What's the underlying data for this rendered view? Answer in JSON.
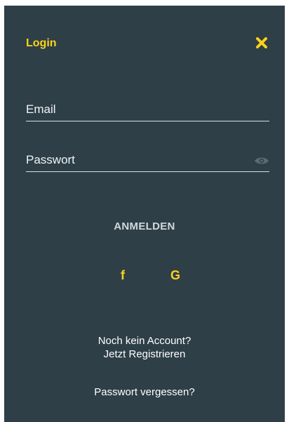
{
  "dialog": {
    "title": "Login",
    "close_icon": "close-icon"
  },
  "form": {
    "email": {
      "placeholder": "Email",
      "value": ""
    },
    "password": {
      "placeholder": "Passwort",
      "value": "",
      "toggle_icon": "eye-icon"
    },
    "submit_label": "ANMELDEN"
  },
  "social": {
    "facebook": "f",
    "google": "G"
  },
  "footer": {
    "register_prompt": "Noch kein Account?",
    "register_link": "Jetzt Registrieren",
    "forgot_password": "Passwort vergessen?"
  },
  "colors": {
    "background": "#2e3f48",
    "accent": "#ffd11a",
    "text": "#ffffff"
  }
}
